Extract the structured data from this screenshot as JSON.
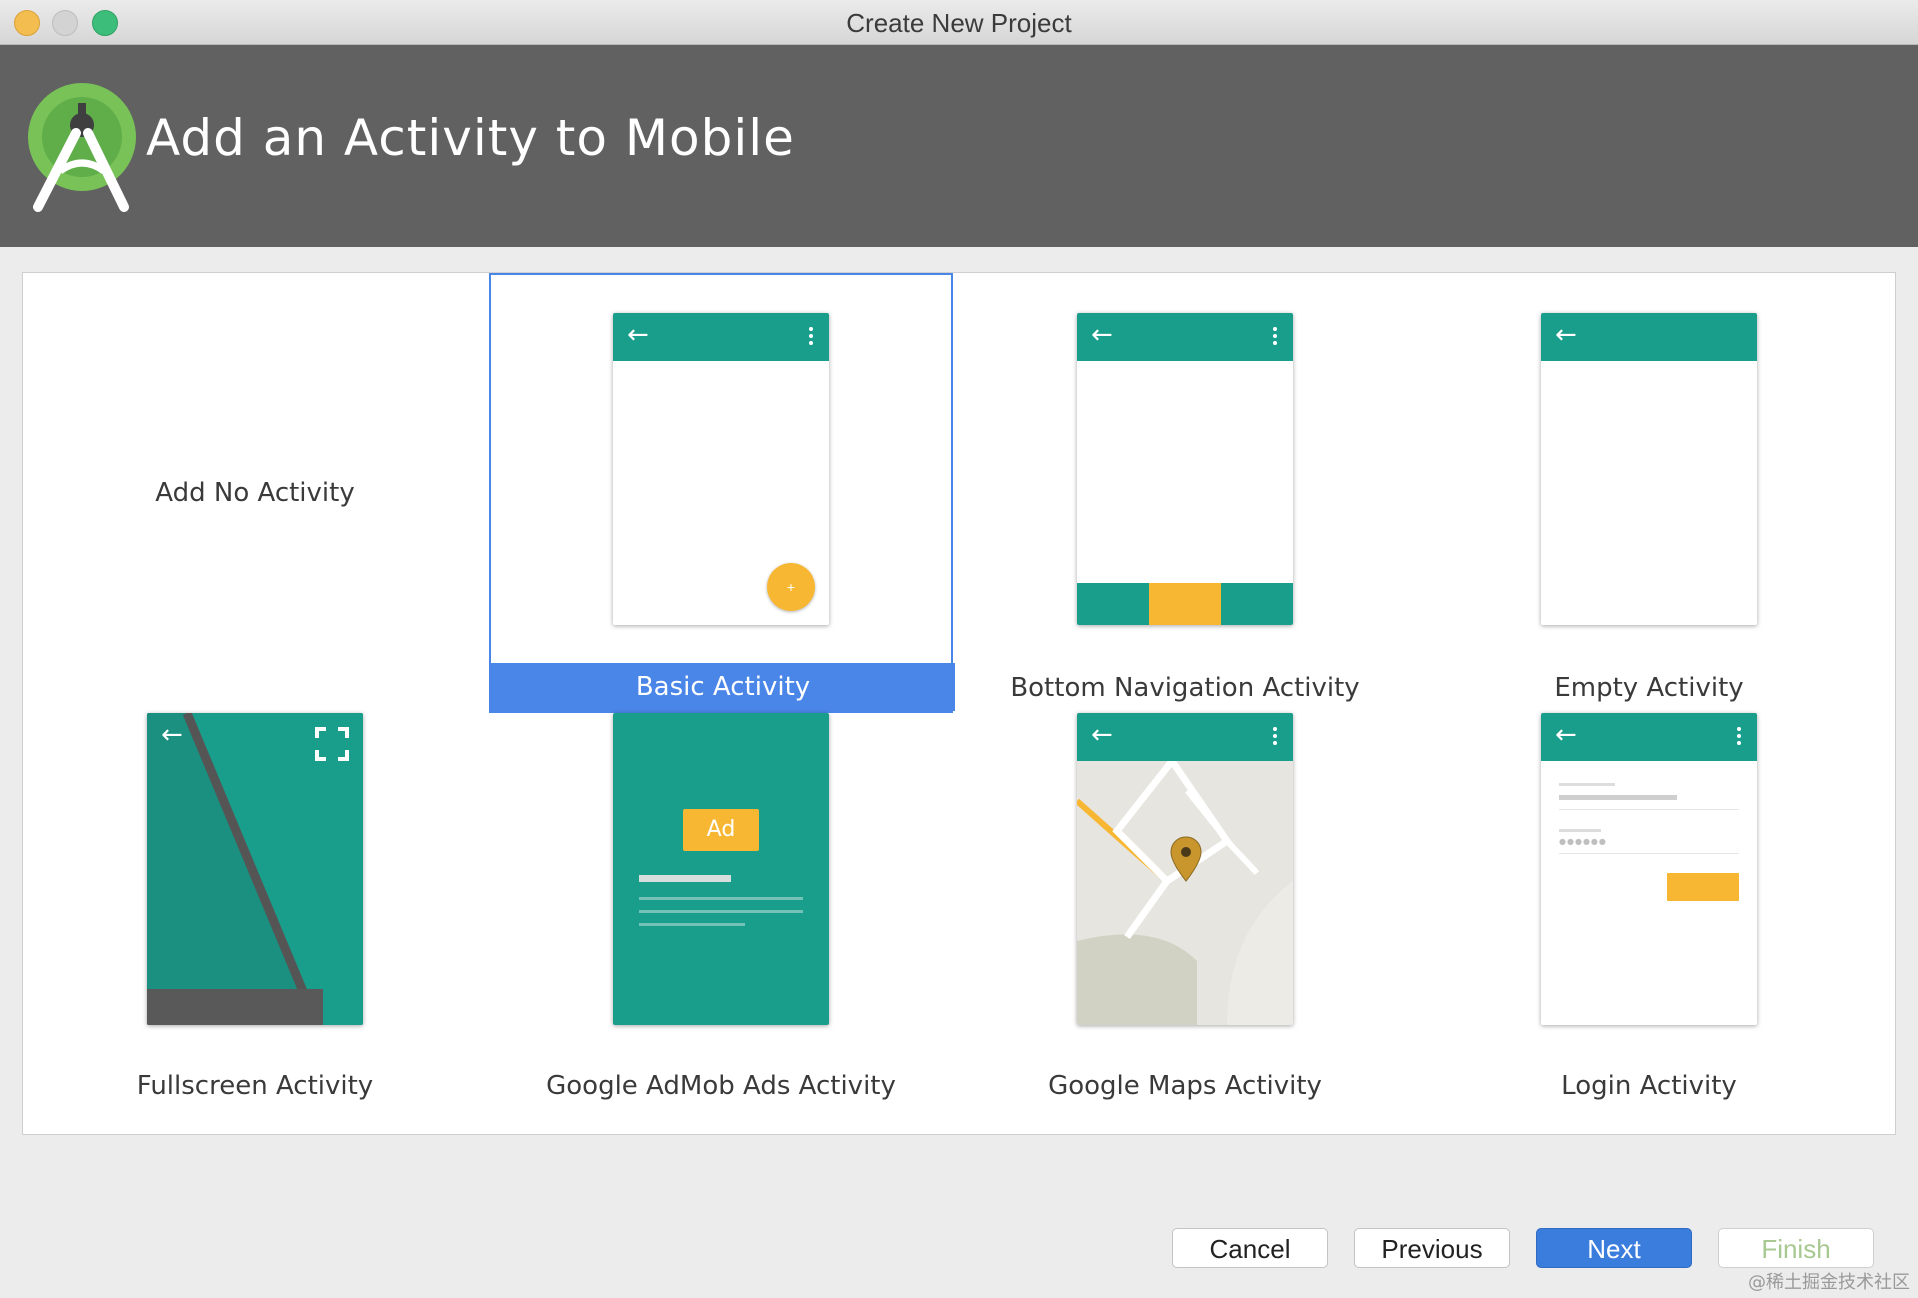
{
  "window": {
    "title": "Create New Project"
  },
  "header": {
    "title": "Add an Activity to Mobile"
  },
  "activities": [
    {
      "label": "Add No Activity",
      "selected": false
    },
    {
      "label": "Basic Activity",
      "selected": true
    },
    {
      "label": "Bottom Navigation Activity",
      "selected": false
    },
    {
      "label": "Empty Activity",
      "selected": false
    },
    {
      "label": "Fullscreen Activity",
      "selected": false
    },
    {
      "label": "Google AdMob Ads Activity",
      "selected": false
    },
    {
      "label": "Google Maps Activity",
      "selected": false
    },
    {
      "label": "Login Activity",
      "selected": false
    }
  ],
  "admob": {
    "ad_label": "Ad"
  },
  "login": {
    "password_mask": "●●●●●●"
  },
  "icons": {
    "back": "←",
    "fab": "+"
  },
  "footer": {
    "cancel": "Cancel",
    "previous": "Previous",
    "next": "Next",
    "finish": "Finish"
  },
  "watermark": "@稀土掘金技术社区",
  "colors": {
    "accent": "#4a86e8",
    "teal": "#1a9e8c",
    "amber": "#f7b733",
    "header_bg": "#616161"
  }
}
